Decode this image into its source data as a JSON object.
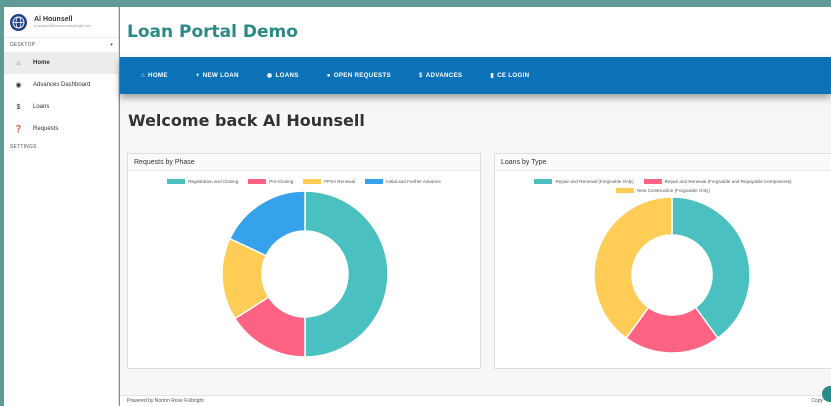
{
  "profile": {
    "name": "Al Hounsell",
    "email": "al.hounsell@nortonrosefulbright.com"
  },
  "sidebar": {
    "section_desktop": "DESKTOP",
    "section_settings": "SETTINGS",
    "items": [
      {
        "label": "Home",
        "icon": "home-icon",
        "active": true
      },
      {
        "label": "Advances Dashboard",
        "icon": "dashboard-icon",
        "active": false
      },
      {
        "label": "Loans",
        "icon": "dollar-icon",
        "active": false
      },
      {
        "label": "Requests",
        "icon": "question-icon",
        "active": false
      }
    ]
  },
  "header": {
    "title": "Loan Portal Demo"
  },
  "navbar": {
    "items": [
      {
        "label": "HOME",
        "icon": "home-icon"
      },
      {
        "label": "NEW LOAN",
        "icon": "plus-icon"
      },
      {
        "label": "LOANS",
        "icon": "circle-dollar-icon"
      },
      {
        "label": "OPEN REQUESTS",
        "icon": "question-circle-icon"
      },
      {
        "label": "ADVANCES",
        "icon": "dollar-icon"
      },
      {
        "label": "CE LOGIN",
        "icon": "file-icon"
      }
    ]
  },
  "welcome": "Welcome back Al Hounsell",
  "footer": {
    "left": "Powered by Norton Rose Fulbright",
    "right": "Copy"
  },
  "chart_data": [
    {
      "type": "pie",
      "title": "Requests by Phase",
      "categories": [
        "Registration and Closing",
        "Pre-Closing",
        "FPSA Renewal",
        "Initial and Further Advance"
      ],
      "values": [
        50,
        16,
        16,
        18
      ],
      "colors": [
        "#4bc0c0",
        "#ff6384",
        "#ffcd56",
        "#36a2eb"
      ]
    },
    {
      "type": "pie",
      "title": "Loans by Type",
      "categories": [
        "Repair and Renewal (Forgivable Only)",
        "Repair and Renewal (Forgivable and Repayable Components)",
        "New Construction (Forgivable Only)"
      ],
      "values": [
        40,
        20,
        40
      ],
      "colors": [
        "#4bc0c0",
        "#ff6384",
        "#ffcd56"
      ]
    }
  ]
}
